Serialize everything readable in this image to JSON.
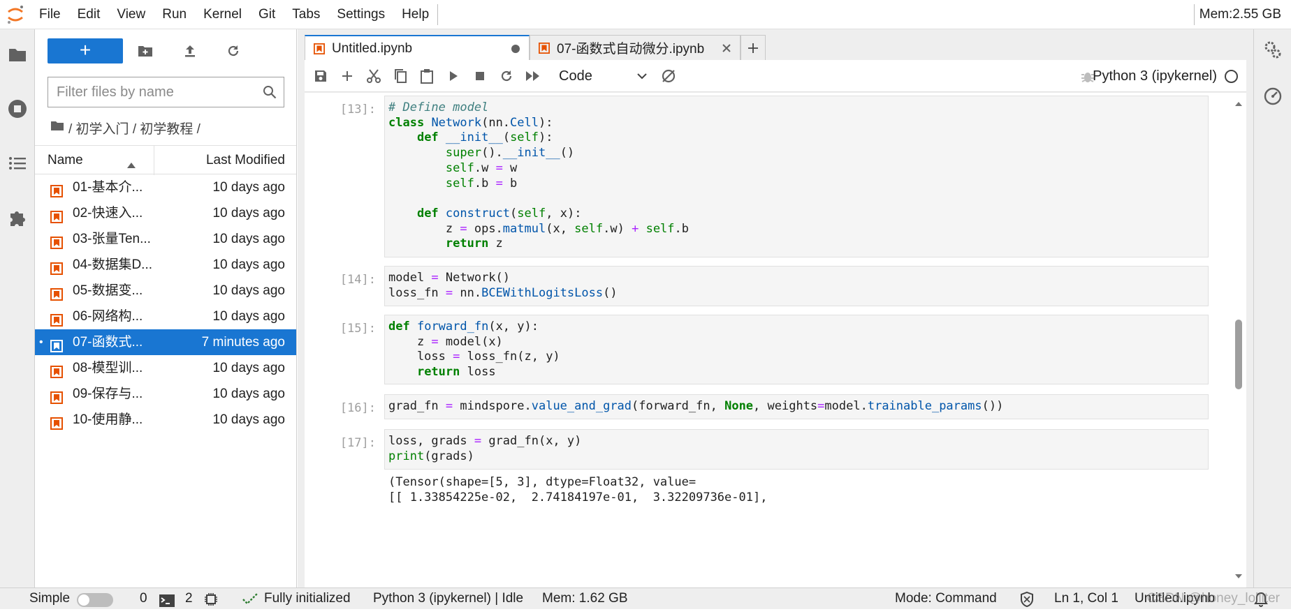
{
  "menubar": {
    "items": [
      "File",
      "Edit",
      "View",
      "Run",
      "Kernel",
      "Git",
      "Tabs",
      "Settings",
      "Help"
    ],
    "memory": "Mem:2.55 GB"
  },
  "filebrowser": {
    "new_label": "+",
    "filter_placeholder": "Filter files by name",
    "breadcrumb": "/ 初学入门 / 初学教程 /",
    "col_name": "Name",
    "col_modified": "Last Modified",
    "files": [
      {
        "name": "01-基本介...",
        "modified": "10 days ago"
      },
      {
        "name": "02-快速入...",
        "modified": "10 days ago"
      },
      {
        "name": "03-张量Ten...",
        "modified": "10 days ago"
      },
      {
        "name": "04-数据集D...",
        "modified": "10 days ago"
      },
      {
        "name": "05-数据变...",
        "modified": "10 days ago"
      },
      {
        "name": "06-网络构...",
        "modified": "10 days ago"
      },
      {
        "name": "07-函数式...",
        "modified": "7 minutes ago",
        "selected_marker": "•"
      },
      {
        "name": "08-模型训...",
        "modified": "10 days ago"
      },
      {
        "name": "09-保存与...",
        "modified": "10 days ago"
      },
      {
        "name": "10-使用静...",
        "modified": "10 days ago"
      }
    ]
  },
  "tabs": [
    {
      "label": "Untitled.ipynb"
    },
    {
      "label": "07-函数式自动微分.ipynb"
    }
  ],
  "toolbar": {
    "cell_type": "Code",
    "kernel": "Python 3 (ipykernel)"
  },
  "cells": [
    {
      "prompt": "[13]:"
    },
    {
      "prompt": "[14]:"
    },
    {
      "prompt": "[15]:"
    },
    {
      "prompt": "[16]:"
    },
    {
      "prompt": "[17]:"
    }
  ],
  "output": {
    "line1": "(Tensor(shape=[5, 3], dtype=Float32, value=",
    "line2": "[[ 1.33854225e-02,  2.74184197e-01,  3.32209736e-01],"
  },
  "statusbar": {
    "simple_label": "Simple",
    "terminals": "0",
    "kernels": "2",
    "init_status": "Fully initialized",
    "kernel_status": "Python 3 (ipykernel) | Idle",
    "mem": "Mem: 1.62 GB",
    "mode": "Mode: Command",
    "position": "Ln 1, Col 1",
    "file": "Untitled.ipynb",
    "watermark": "CSDN @honey_lolliter"
  },
  "colors": {
    "accent": "#1976d2",
    "notebook_icon": "#e65100"
  }
}
